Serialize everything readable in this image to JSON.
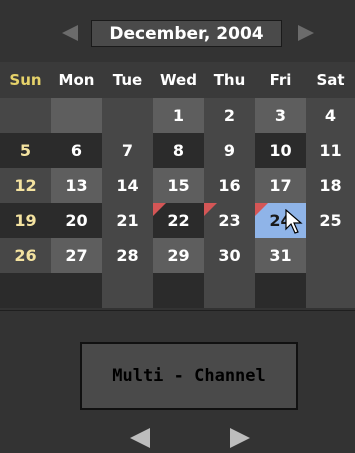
{
  "calendar": {
    "month_label": "December, 2004",
    "weekdays": [
      "Sun",
      "Mon",
      "Tue",
      "Wed",
      "Thu",
      "Fri",
      "Sat"
    ],
    "weeks": [
      [
        "",
        "",
        "",
        "1",
        "2",
        "3",
        "4"
      ],
      [
        "5",
        "6",
        "7",
        "8",
        "9",
        "10",
        "11"
      ],
      [
        "12",
        "13",
        "14",
        "15",
        "16",
        "17",
        "18"
      ],
      [
        "19",
        "20",
        "21",
        "22",
        "23",
        "24",
        "25"
      ],
      [
        "26",
        "27",
        "28",
        "29",
        "30",
        "31",
        ""
      ],
      [
        "",
        "",
        "",
        "",
        "",
        "",
        ""
      ]
    ],
    "selected_day": "24",
    "marked_days": [
      "22",
      "23",
      "24"
    ]
  },
  "footer": {
    "multi_channel_label": "Multi - Channel"
  },
  "icons": {
    "prev_month": "triangle-left",
    "next_month": "triangle-right",
    "prev_page": "triangle-left",
    "next_page": "triangle-right",
    "cursor": "arrow-cursor"
  },
  "colors": {
    "selected": "#8fb4e8",
    "marker": "#d45656",
    "sunday": "#f4e3a0"
  }
}
